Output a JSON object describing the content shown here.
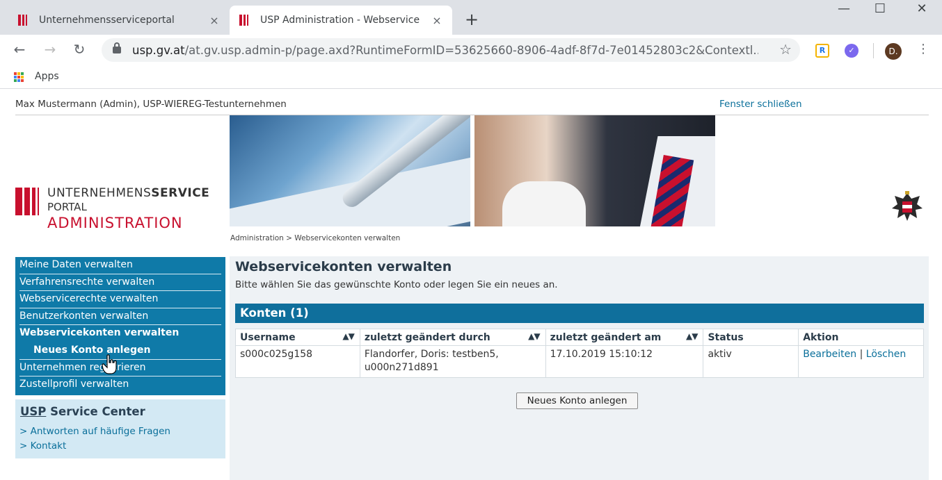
{
  "browser": {
    "tabs": [
      {
        "title": "Unternehmensserviceportal",
        "close": "×"
      },
      {
        "title": "USP Administration - Webservice",
        "close": "×"
      }
    ],
    "new_tab": "+",
    "window": {
      "minimize": "—",
      "maximize": "☐",
      "close": "✕"
    },
    "nav": {
      "back": "←",
      "forward": "→",
      "reload": "↻"
    },
    "url_host": "usp.gv.at",
    "url_path": "/at.gv.usp.admin-p/page.axd?RuntimeFormID=53625660-8906-4adf-8f7d-7e01452803c2&Contextl...",
    "star": "☆",
    "extensions": {
      "r": "R",
      "v": "✓"
    },
    "profile_initial": "D.",
    "menu": "⋮",
    "bookmarks": {
      "apps_label": "Apps"
    }
  },
  "header": {
    "user": "Max Mustermann (Admin), USP-WIEREG-Testunternehmen",
    "close_window": "Fenster schließen"
  },
  "logo": {
    "line1_light": "UNTERNEHMENS",
    "line1_bold": "SERVICE",
    "line2": "PORTAL",
    "line3": "ADMINISTRATION"
  },
  "breadcrumb": "Administration > Webservicekonten verwalten",
  "sidebar": {
    "items": [
      {
        "label": "Meine Daten verwalten"
      },
      {
        "label": "Verfahrensrechte verwalten"
      },
      {
        "label": "Webservicerechte verwalten"
      },
      {
        "label": "Benutzerkonten verwalten"
      },
      {
        "label": "Webservicekonten verwalten"
      },
      {
        "label": "Neues Konto anlegen"
      },
      {
        "label": "Unternehmen registrieren"
      },
      {
        "label": "Zustellprofil verwalten"
      }
    ],
    "service_center": {
      "title_underlined": "USP",
      "title_rest": " Service Center",
      "links": [
        "> Antworten auf häufige Fragen",
        "> Kontakt"
      ]
    }
  },
  "main": {
    "title": "Webservicekonten verwalten",
    "intro": "Bitte wählen Sie das gewünschte Konto oder legen Sie ein neues an.",
    "section_title": "Konten (1)",
    "sort_glyph": "▲▼",
    "columns": [
      "Username",
      "zuletzt geändert durch",
      "zuletzt geändert am",
      "Status",
      "Aktion"
    ],
    "rows": [
      {
        "username": "s000c025g158",
        "changed_by_line1": "Flandorfer, Doris: testben5,",
        "changed_by_line2": "u000n271d891",
        "changed_at": "17.10.2019 15:10:12",
        "status": "aktiv",
        "edit": "Bearbeiten",
        "sep": "|",
        "delete": "Löschen"
      }
    ],
    "new_account_button": "Neues Konto anlegen"
  },
  "colors": {
    "nav_blue": "#0f7aa8",
    "header_blue": "#0f6f9c",
    "link": "#0a6f9a",
    "brand_red": "#c8102e",
    "service_bg": "#d3e9f4",
    "content_bg": "#eef2f5"
  }
}
